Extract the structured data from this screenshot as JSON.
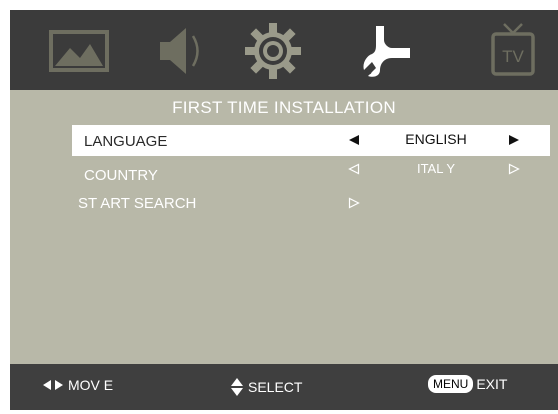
{
  "tabs": [
    {
      "name": "picture",
      "icon": "picture-icon",
      "active": false
    },
    {
      "name": "sound",
      "icon": "speaker-icon",
      "active": false
    },
    {
      "name": "setup",
      "icon": "gear-icon",
      "active": false
    },
    {
      "name": "installation",
      "icon": "wrench-icon",
      "active": true
    },
    {
      "name": "tv",
      "icon": "tv-icon",
      "active": false,
      "label": "TV"
    }
  ],
  "panel": {
    "title": "FIRST TIME INSTALLATION",
    "rows": [
      {
        "label": "LANGUAGE",
        "value": "ENGLISH",
        "selected": true
      },
      {
        "label": "COUNTRY",
        "value": "ITAL Y",
        "selected": false
      },
      {
        "label": "ST ART SEARCH",
        "value": "",
        "selected": false
      }
    ]
  },
  "footer": {
    "move_label": "MOV E",
    "select_label": "SELECT",
    "menu_key": "MENU",
    "exit_label": "EXIT"
  },
  "colors": {
    "frame": "#3f3f3f",
    "panel": "#b8b8a8",
    "selected_row": "#ffffff",
    "active_icon": "#ffffff",
    "inactive_icon": "#6e6e60"
  }
}
